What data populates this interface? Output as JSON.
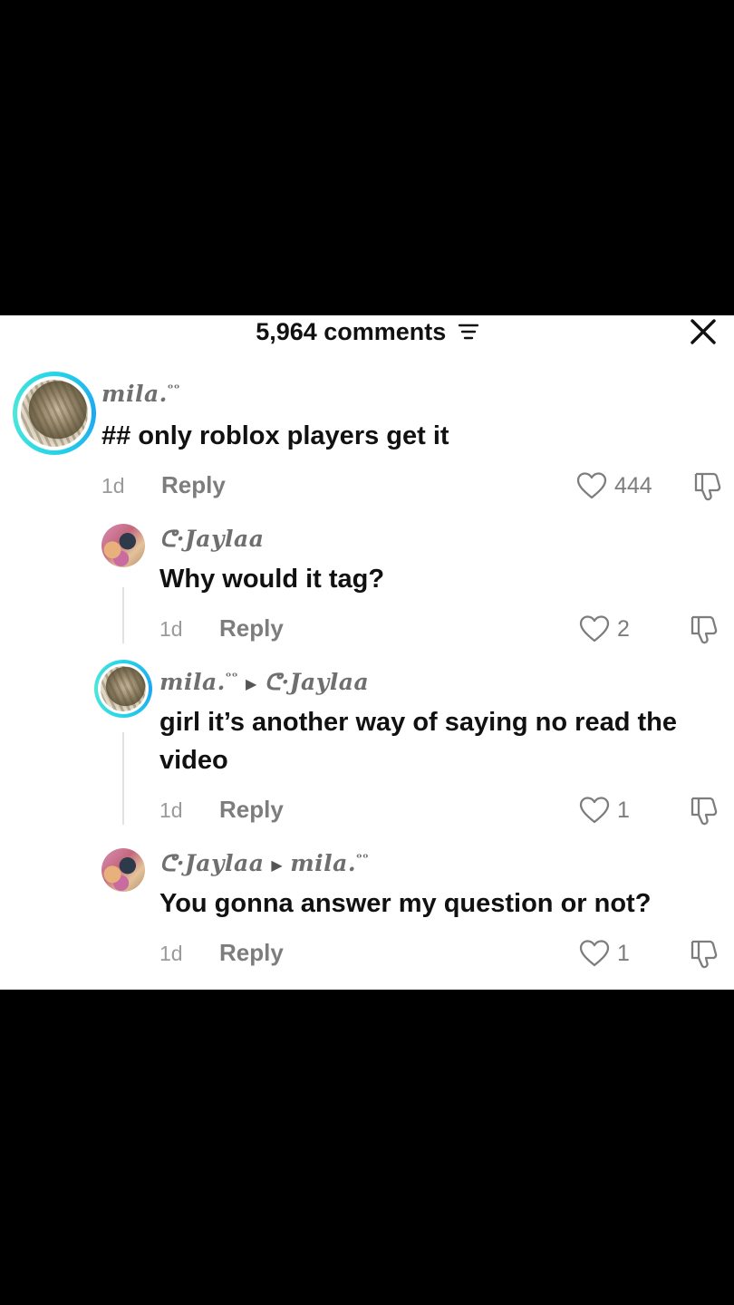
{
  "header": {
    "comment_count": "5,964 comments",
    "icons": {
      "filter": "filter-icon",
      "close": "close-icon"
    }
  },
  "comments": [
    {
      "username": "mila.",
      "username_sup": "ᵒᵒ",
      "text": "## only roblox players get it",
      "time": "1d",
      "reply_label": "Reply",
      "likes": "444"
    },
    {
      "username": "ᕦ·Jaylaa",
      "text": "Why would it tag?",
      "time": "1d",
      "reply_label": "Reply",
      "likes": "2"
    },
    {
      "username": "mila.",
      "username_sup": "ᵒᵒ",
      "reply_to": "ᕦ·Jaylaa",
      "text": "girl it’s another way of saying no read the video",
      "time": "1d",
      "reply_label": "Reply",
      "likes": "1"
    },
    {
      "username": "ᕦ·Jaylaa",
      "reply_to": "mila.",
      "reply_to_sup": "ᵒᵒ",
      "text": "You gonna answer my question or not?",
      "time": "1d",
      "reply_label": "Reply",
      "likes": "1"
    }
  ],
  "colors": {
    "ring": "#25d5e8",
    "meta_gray": "#9a9a9a",
    "text": "#111111",
    "sheet_bg": "#ffffff",
    "backdrop": "#000000"
  }
}
